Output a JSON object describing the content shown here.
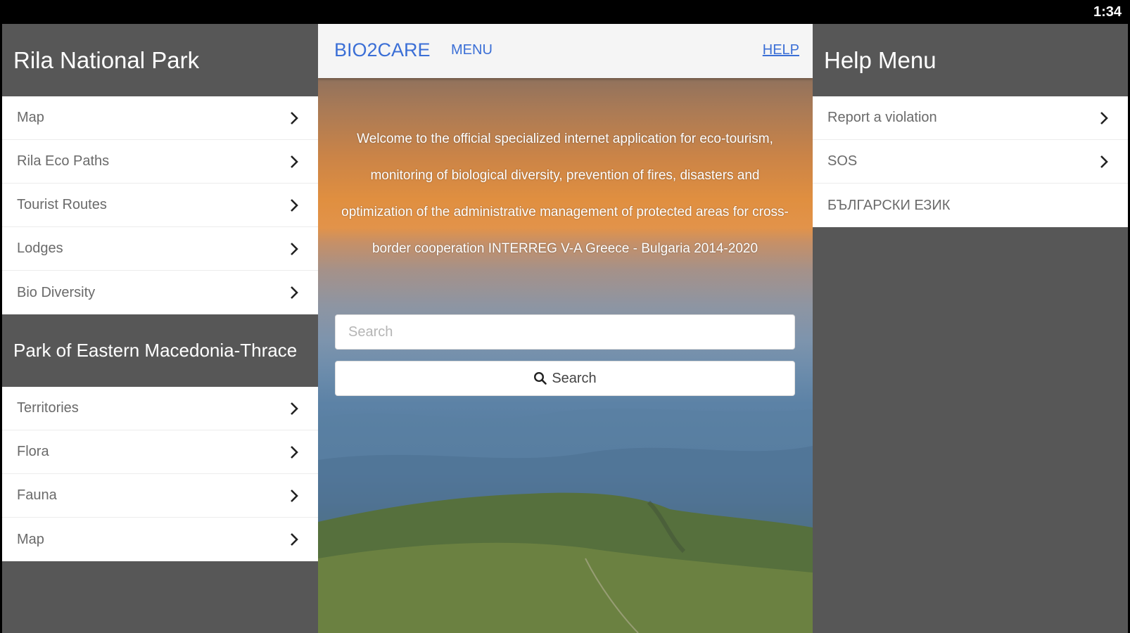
{
  "status_bar": {
    "time": "1:34"
  },
  "left_panel": {
    "rila": {
      "title": "Rila National Park",
      "items": [
        {
          "label": "Map",
          "icon": "chevron-right-icon"
        },
        {
          "label": "Rila Eco Paths",
          "icon": "chevron-right-icon"
        },
        {
          "label": "Tourist Routes",
          "icon": "chevron-right-icon"
        },
        {
          "label": "Lodges",
          "icon": "chevron-right-icon"
        },
        {
          "label": "Bio Diversity",
          "icon": "chevron-right-icon"
        }
      ]
    },
    "macedonia": {
      "title": "Park of Eastern Macedonia-Thrace",
      "items": [
        {
          "label": "Territories",
          "icon": "chevron-right-icon"
        },
        {
          "label": "Flora",
          "icon": "chevron-right-icon"
        },
        {
          "label": "Fauna",
          "icon": "chevron-right-icon"
        },
        {
          "label": "Map",
          "icon": "chevron-right-icon"
        }
      ]
    }
  },
  "center": {
    "brand": "BIO2CARE",
    "menu_label": "MENU",
    "help_label": "HELP",
    "welcome_text": "Welcome to the official specialized internet application for eco-tourism, monitoring of biological diversity, prevention of fires, disasters and optimization of the administrative management of protected areas for cross-border cooperation INTERREG V-A Greece - Bulgaria 2014-2020",
    "search": {
      "placeholder": "Search",
      "value": "",
      "button_label": "Search",
      "button_icon": "search-icon"
    },
    "colors": {
      "link": "#3b6fd6",
      "topbar": "#f5f5f5"
    }
  },
  "right_panel": {
    "title": "Help Menu",
    "items": [
      {
        "label": "Report a violation",
        "icon": "chevron-right-icon"
      },
      {
        "label": "SOS",
        "icon": "chevron-right-icon"
      },
      {
        "label": "БЪЛГАРСКИ ЕЗИК",
        "icon": ""
      }
    ]
  },
  "colors": {
    "panel_bg": "#575757",
    "status_bar": "#000000"
  }
}
